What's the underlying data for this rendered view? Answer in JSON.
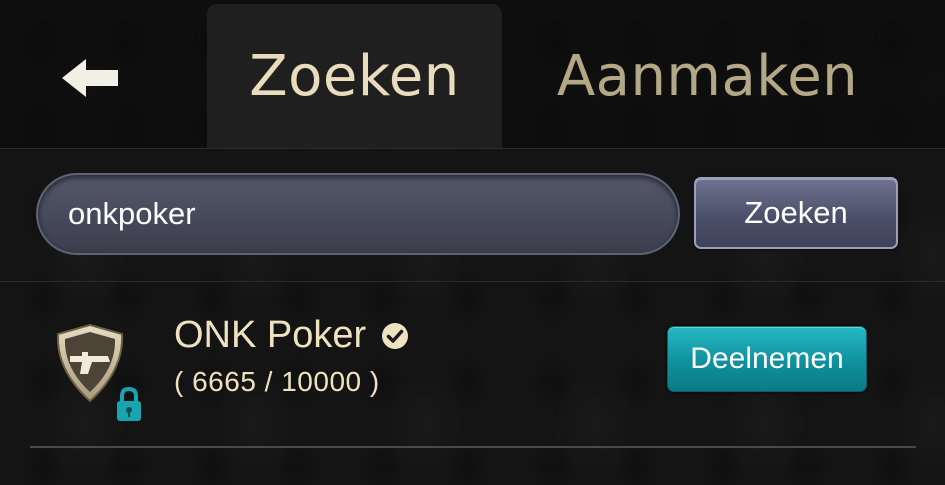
{
  "header": {
    "back_icon": "arrow-left-icon",
    "tabs": [
      {
        "label": "Zoeken",
        "active": true
      },
      {
        "label": "Aanmaken",
        "active": false
      }
    ]
  },
  "search": {
    "value": "onkpoker",
    "button_label": "Zoeken"
  },
  "results": [
    {
      "name": "ONK Poker",
      "verified_icon": "check-circle-icon",
      "logo_icon": "pistol-shield-logo",
      "locked_icon": "lock-icon",
      "members": "( 6665 / 10000 )",
      "join_label": "Deelnemen"
    }
  ],
  "colors": {
    "accent_teal": "#1aa3ae",
    "text_cream": "#efe2c0",
    "tab_inactive": "#b3a886"
  }
}
